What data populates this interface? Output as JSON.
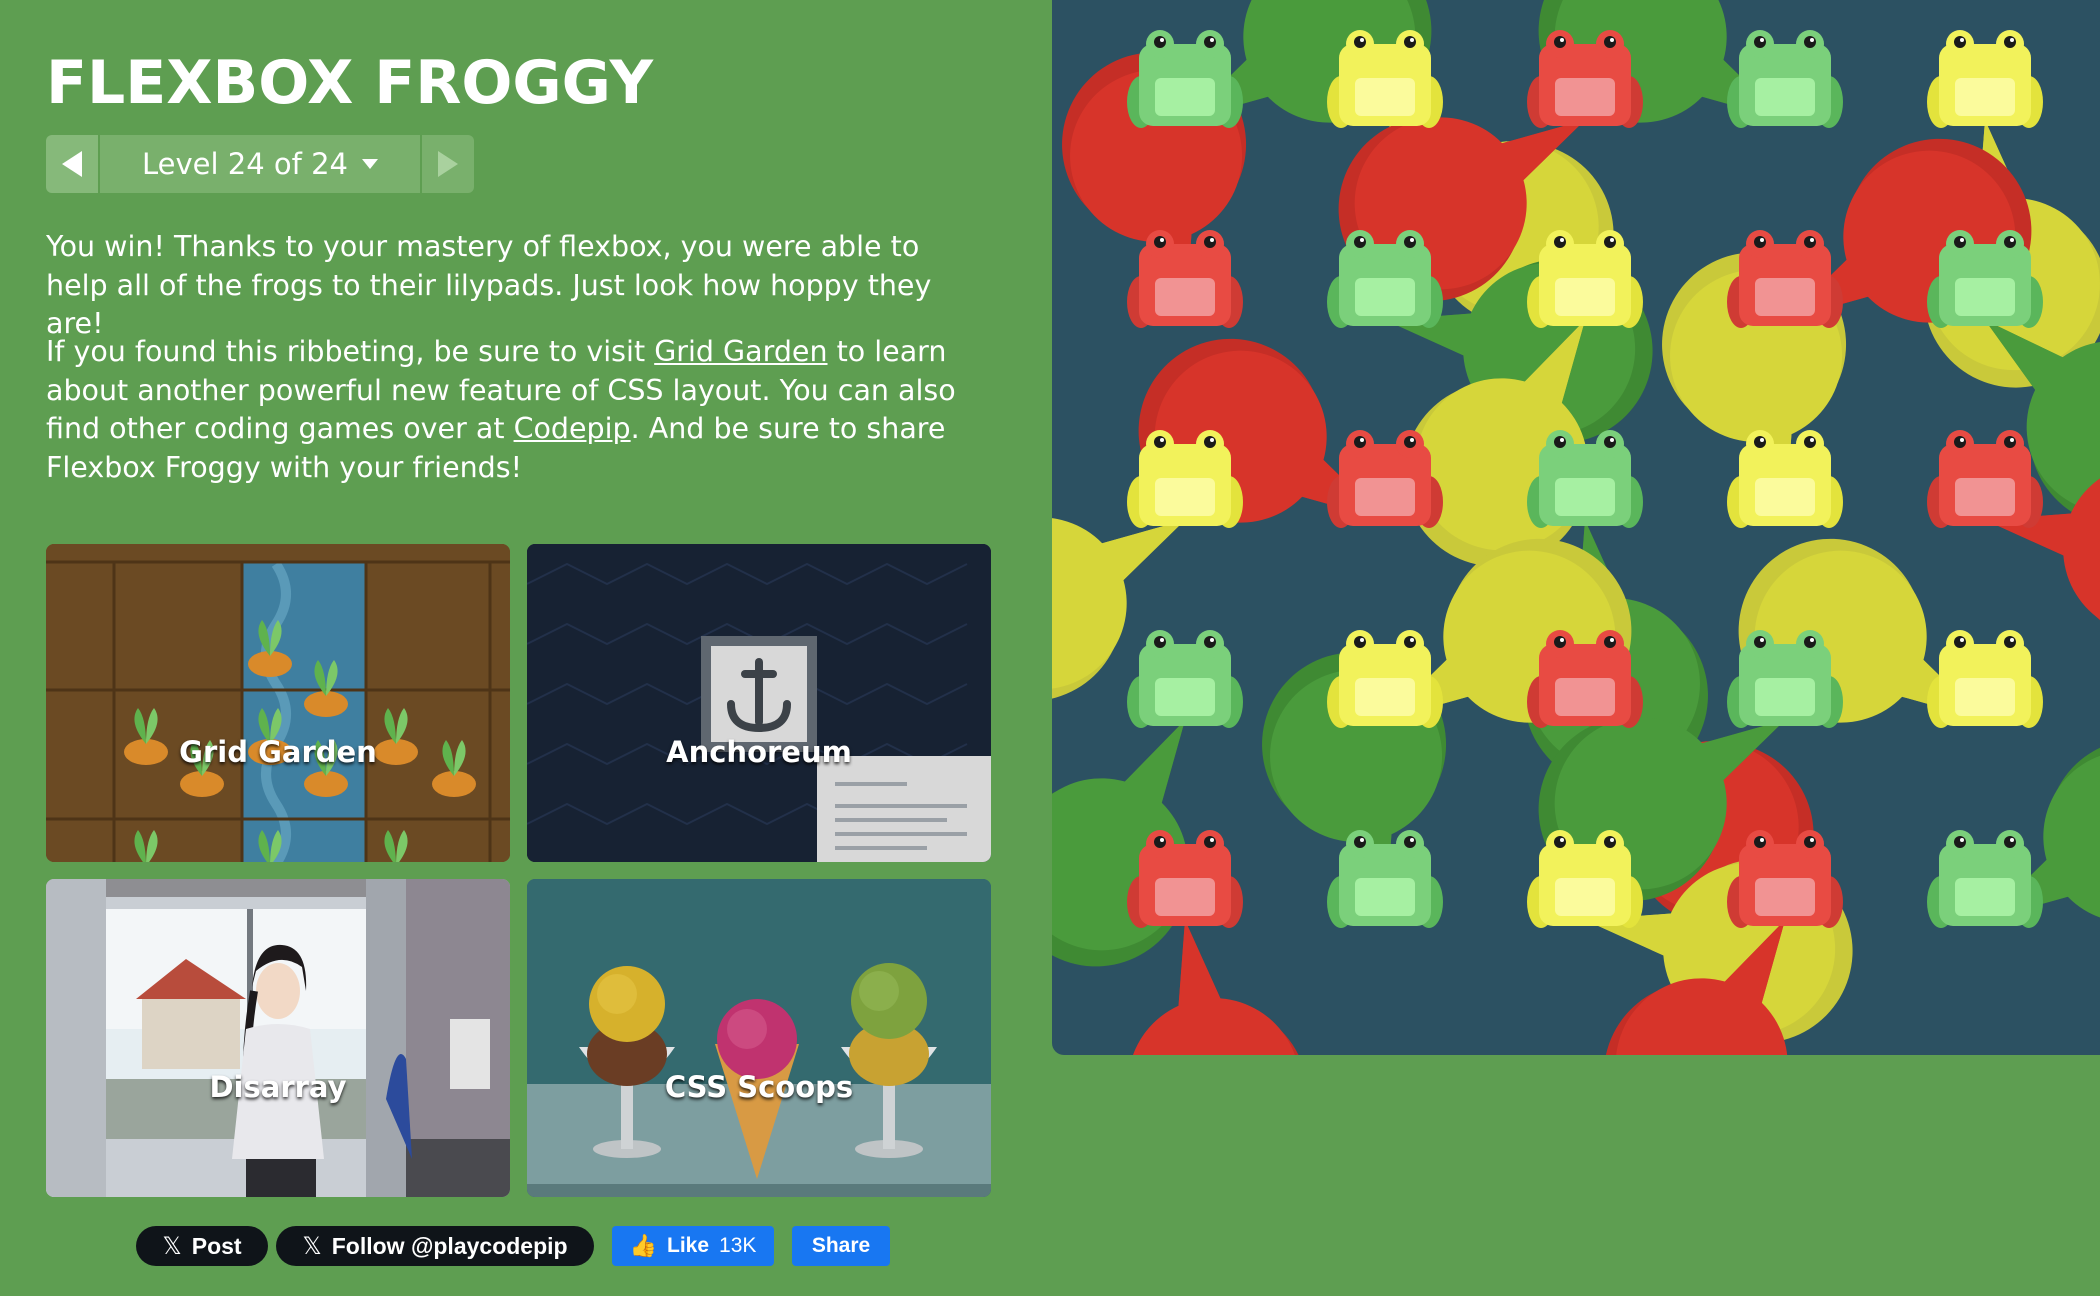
{
  "header": {
    "title": "FLEXBOX FROGGY",
    "level_label": "Level 24 of 24"
  },
  "content": {
    "p1": "You win! Thanks to your mastery of flexbox, you were able to help all of the frogs to their lilypads. Just look how hoppy they are!",
    "p2_before": "If you found this ribbeting, be sure to visit ",
    "p2_link1": "Grid Garden",
    "p2_middle": " to learn about another powerful new feature of CSS layout. You can also find other coding games over at ",
    "p2_link2": "Codepip",
    "p2_after": ". And be sure to share Flexbox Froggy with your friends!"
  },
  "games": [
    {
      "label": "Grid Garden"
    },
    {
      "label": "Anchoreum"
    },
    {
      "label": "Disarray"
    },
    {
      "label": "CSS Scoops"
    }
  ],
  "social": {
    "post_label": "Post",
    "follow_label": "Follow @playcodepip",
    "like_label": "Like",
    "like_count": "13K",
    "share_label": "Share"
  },
  "board": {
    "colors": {
      "green": "#4a9b3c",
      "yellow": "#d6d63a",
      "red": "#d7342a"
    },
    "lilypads": [
      [
        "green",
        "yellow",
        "red",
        "green",
        "yellow"
      ],
      [
        "red",
        "green",
        "yellow",
        "red",
        "green"
      ],
      [
        "yellow",
        "red",
        "green",
        "yellow",
        "red"
      ],
      [
        "green",
        "yellow",
        "red",
        "green",
        "yellow"
      ],
      [
        "red",
        "green",
        "yellow",
        "red",
        "green"
      ]
    ],
    "frogs": [
      [
        "green",
        "yellow",
        "red",
        "green",
        "yellow"
      ],
      [
        "red",
        "green",
        "yellow",
        "red",
        "green"
      ],
      [
        "yellow",
        "red",
        "green",
        "yellow",
        "red"
      ],
      [
        "green",
        "yellow",
        "red",
        "green",
        "yellow"
      ],
      [
        "red",
        "green",
        "yellow",
        "red",
        "green"
      ]
    ]
  }
}
